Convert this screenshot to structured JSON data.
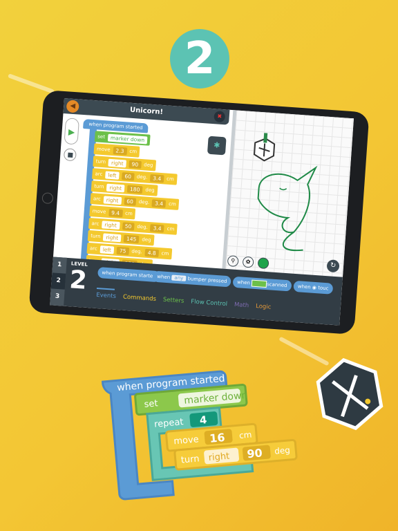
{
  "step_number": "2",
  "app": {
    "title": "Unicorn!",
    "program": {
      "hat": "when program started",
      "blocks": [
        {
          "op": "set",
          "arg": "marker down"
        },
        {
          "op": "move",
          "val": "2.3",
          "unit": "cm"
        },
        {
          "op": "turn",
          "dir": "right",
          "val": "90",
          "unit": "deg"
        },
        {
          "op": "arc",
          "dir": "left",
          "val": "60",
          "unit": "deg.",
          "val2": "3.4",
          "unit2": "cm"
        },
        {
          "op": "turn",
          "dir": "right",
          "val": "180",
          "unit": "deg"
        },
        {
          "op": "arc",
          "dir": "right",
          "val": "60",
          "unit": "deg.",
          "val2": "3.4",
          "unit2": "cm"
        },
        {
          "op": "move",
          "val": "9.4",
          "unit": "cm"
        },
        {
          "op": "arc",
          "dir": "right",
          "val": "50",
          "unit": "deg.",
          "val2": "3.4",
          "unit2": "cm"
        },
        {
          "op": "turn",
          "dir": "right",
          "val": "145",
          "unit": "deg"
        },
        {
          "op": "arc",
          "dir": "left",
          "val": "75",
          "unit": "deg.",
          "val2": "4.8",
          "unit2": "cm"
        },
        {
          "op": "turn",
          "dir": "right",
          "val": "180",
          "unit": "deg"
        }
      ]
    },
    "level": {
      "label": "LEVEL",
      "current": "2",
      "options": [
        "1",
        "2",
        "3"
      ]
    },
    "palette_blocks": [
      {
        "text": "when program started"
      },
      {
        "pre": "when",
        "mid": "any",
        "post": "bumper pressed"
      },
      {
        "pre": "when",
        "post": "scanned"
      },
      {
        "pre": "when",
        "post": "touc"
      }
    ],
    "categories": [
      {
        "label": "Events",
        "color": "#5b9bd5"
      },
      {
        "label": "Commands",
        "color": "#f4c92e"
      },
      {
        "label": "Setters",
        "color": "#6cc04a"
      },
      {
        "label": "Flow Control",
        "color": "#5cc3b3"
      },
      {
        "label": "Math",
        "color": "#7e6bb0"
      },
      {
        "label": "Logic",
        "color": "#e59a3a"
      }
    ]
  },
  "showcase": {
    "hat": "when program started",
    "set": "set",
    "set_arg": "marker down",
    "repeat": "repeat",
    "repeat_val": "4",
    "move": "move",
    "move_val": "16",
    "move_unit": "cm",
    "turn": "turn",
    "turn_dir": "right",
    "turn_val": "90",
    "turn_unit": "deg"
  },
  "colors": {
    "background": "#f2c935",
    "accent": "#5cc3b3",
    "events": "#5b9bd5",
    "commands": "#f4c92e",
    "setters": "#6cc04a",
    "flow": "#5cc3b3"
  }
}
